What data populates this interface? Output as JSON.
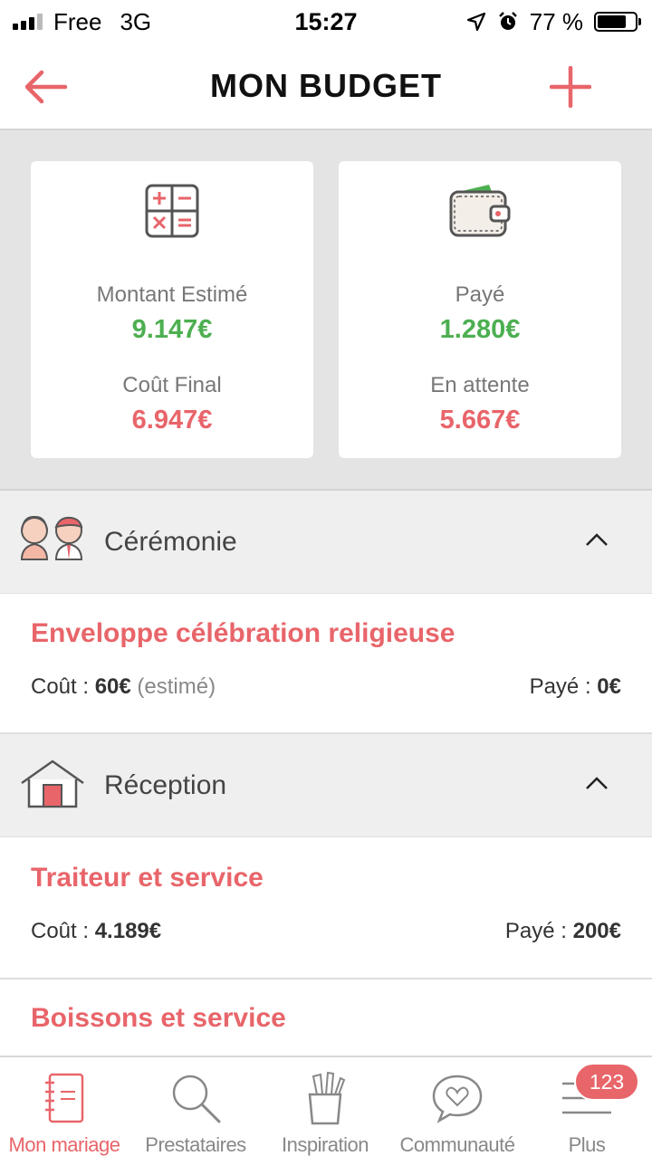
{
  "status_bar": {
    "carrier": "Free",
    "network": "3G",
    "time": "15:27",
    "battery": "77 %",
    "battery_level": 0.77
  },
  "header": {
    "title": "MON BUDGET",
    "accent_color": "#e8656a"
  },
  "summary": {
    "estimated_label": "Montant Estimé",
    "estimated_value": "9.147€",
    "final_label": "Coût Final",
    "final_value": "6.947€",
    "paid_label": "Payé",
    "paid_value": "1.280€",
    "pending_label": "En attente",
    "pending_value": "5.667€"
  },
  "sections": [
    {
      "title": "Cérémonie",
      "items": [
        {
          "title": "Enveloppe célébration religieuse",
          "cost_label": "Coût :",
          "cost_value": "60€",
          "cost_note": "(estimé)",
          "paid_label": "Payé :",
          "paid_value": "0€"
        }
      ]
    },
    {
      "title": "Réception",
      "items": [
        {
          "title": "Traiteur et service",
          "cost_label": "Coût :",
          "cost_value": "4.189€",
          "paid_label": "Payé :",
          "paid_value": "200€"
        },
        {
          "title": "Boissons et service"
        }
      ]
    }
  ],
  "tabbar": {
    "tabs": [
      {
        "label": "Mon mariage",
        "icon": "notebook-icon",
        "active": true
      },
      {
        "label": "Prestataires",
        "icon": "search-icon"
      },
      {
        "label": "Inspiration",
        "icon": "pencil-cup-icon"
      },
      {
        "label": "Communauté",
        "icon": "chat-heart-icon"
      },
      {
        "label": "Plus",
        "icon": "menu-icon"
      }
    ],
    "badge": "123"
  }
}
